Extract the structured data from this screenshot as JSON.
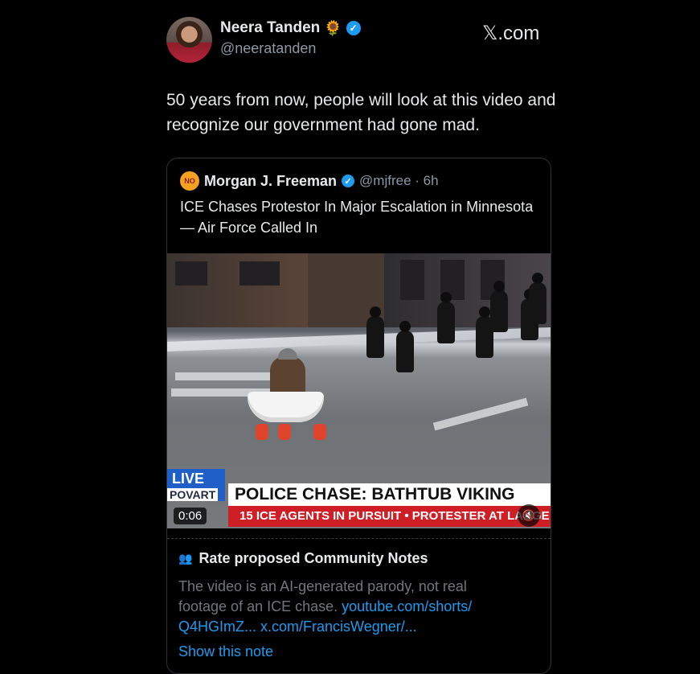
{
  "header": {
    "author_name": "Neera Tanden",
    "name_emoji": "🌻",
    "handle": "@neeratanden",
    "site": "𝕏.com"
  },
  "tweet": {
    "text": "50 years from now, people will look at this video and recognize our government had gone mad."
  },
  "quote": {
    "avatar_text": "NO",
    "author_name": "Morgan J. Freeman",
    "meta": "@mjfree · 6h",
    "text": "ICE Chases Protestor In Major Escalation in Minnesota — Air Force Called In",
    "video": {
      "live_label": "LIVE",
      "live_sub": "POVART",
      "headline": "POLICE CHASE: BATHTUB VIKING",
      "ticker": "15 ICE AGENTS IN PURSUIT • PROTESTER AT LARGE",
      "timer": "0:06"
    }
  },
  "community_notes": {
    "title": "Rate proposed Community Notes",
    "body_text": "The video is an AI-generated parody, not real footage of an ICE chase.",
    "link1": "youtube.com/shorts/ Q4HGImZ...",
    "link2": "x.com/FrancisWegner/...",
    "show_note": "Show this note"
  },
  "icons": [
    "verified-badge-icon",
    "people-icon",
    "mute-icon"
  ],
  "colors": {
    "accent": "#1d9bf0",
    "background": "#000000",
    "chyron_red": "#cf1f26"
  }
}
